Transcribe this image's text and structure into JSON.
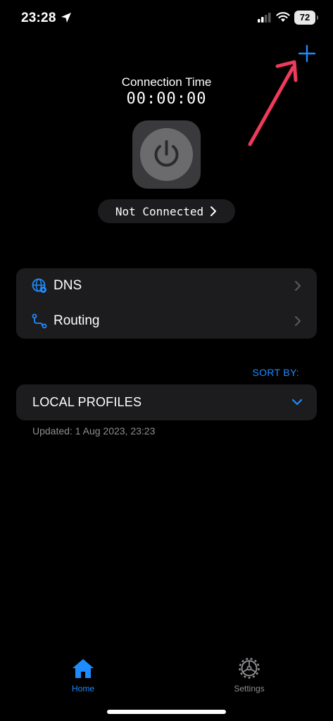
{
  "status_bar": {
    "time": "23:28",
    "battery": "72"
  },
  "connection": {
    "time_label": "Connection Time",
    "time_value": "00:00:00",
    "status": "Not Connected"
  },
  "menu": {
    "dns_label": "DNS",
    "routing_label": "Routing"
  },
  "sort_by": "SORT BY:",
  "profiles": {
    "title": "LOCAL PROFILES",
    "updated": "Updated: 1 Aug 2023, 23:23"
  },
  "tabs": {
    "home": "Home",
    "settings": "Settings"
  },
  "colors": {
    "accent": "#1e8cff",
    "arrow": "#ee3a5b"
  }
}
